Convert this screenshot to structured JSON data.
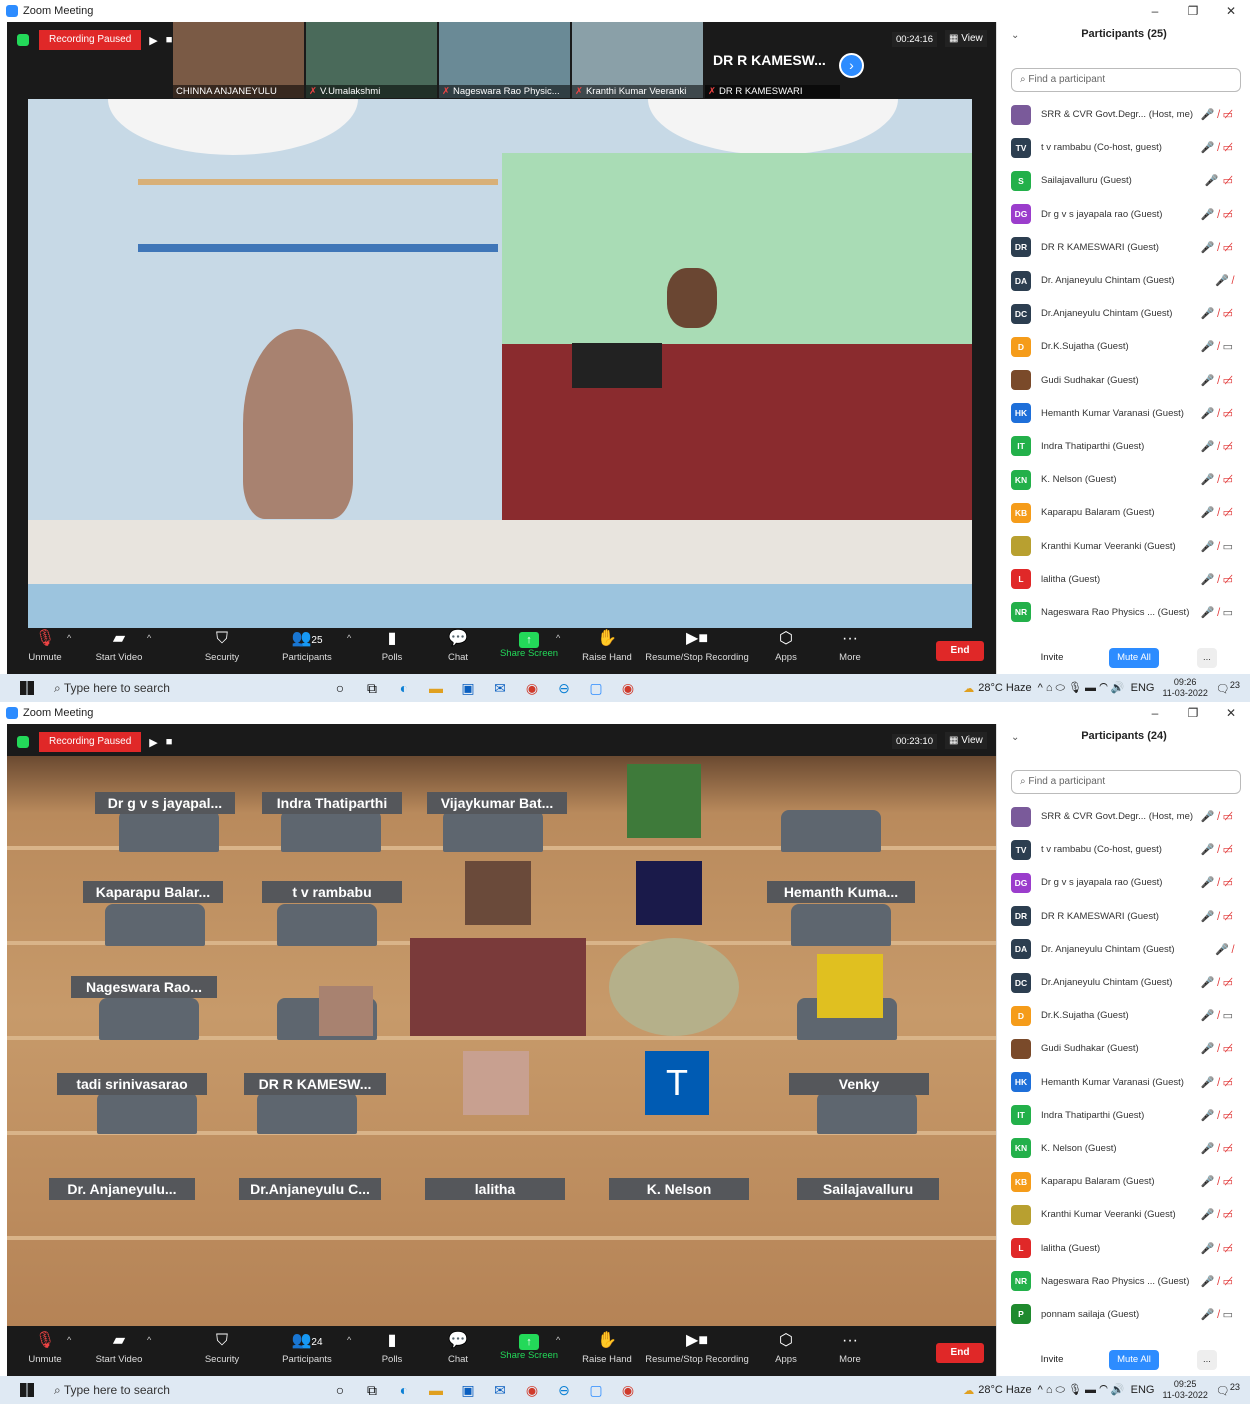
{
  "shot_a": {
    "window_title": "Zoom Meeting",
    "recording": "Recording Paused",
    "timer": "00:24:16",
    "view_label": "View",
    "thumbnails": [
      "CHINNA ANJANEYULU",
      "V.Umalakshmi",
      "Nageswara Rao Physic...",
      "Kranthi Kumar Veeranki"
    ],
    "name_tile_big": "DR R KAMESW...",
    "name_tile_small": "DR R KAMESWARI",
    "participants_title": "Participants (25)",
    "participants_count": "25",
    "participants": [
      {
        "initials": "",
        "name": "SRR & CVR Govt.Degr... (Host, me)",
        "color": "#7a5a9a",
        "icons": "mic-off cam-off"
      },
      {
        "initials": "TV",
        "name": "t v rambabu (Co-host, guest)",
        "color": "#2c3e50",
        "icons": "mic-off cam-off"
      },
      {
        "initials": "S",
        "name": "Sailajavalluru (Guest)",
        "color": "#23b04a",
        "icons": "mic-on cam-off"
      },
      {
        "initials": "DG",
        "name": "Dr g v s jayapala rao (Guest)",
        "color": "#9b3dcc",
        "icons": "mic-off cam-off"
      },
      {
        "initials": "DR",
        "name": "DR R KAMESWARI (Guest)",
        "color": "#2c3e50",
        "icons": "mic-off cam-off"
      },
      {
        "initials": "DA",
        "name": "Dr. Anjaneyulu Chintam (Guest)",
        "color": "#2c3e50",
        "icons": "mic-off"
      },
      {
        "initials": "DC",
        "name": "Dr.Anjaneyulu Chintam (Guest)",
        "color": "#2c3e50",
        "icons": "mic-off cam-off"
      },
      {
        "initials": "D",
        "name": "Dr.K.Sujatha (Guest)",
        "color": "#f59c1a",
        "icons": "mic-off cam-on"
      },
      {
        "initials": "",
        "name": "Gudi Sudhakar (Guest)",
        "color": "#7a4a2a",
        "icons": "mic-off cam-off"
      },
      {
        "initials": "HK",
        "name": "Hemanth Kumar Varanasi (Guest)",
        "color": "#1e6fd9",
        "icons": "mic-off cam-off"
      },
      {
        "initials": "IT",
        "name": "Indra Thatiparthi (Guest)",
        "color": "#23b04a",
        "icons": "mic-off cam-off"
      },
      {
        "initials": "KN",
        "name": "K. Nelson (Guest)",
        "color": "#23b04a",
        "icons": "mic-off cam-off"
      },
      {
        "initials": "KB",
        "name": "Kaparapu Balaram (Guest)",
        "color": "#f59c1a",
        "icons": "mic-off cam-off"
      },
      {
        "initials": "",
        "name": "Kranthi Kumar Veeranki (Guest)",
        "color": "#b8a030",
        "icons": "mic-off cam-on"
      },
      {
        "initials": "L",
        "name": "lalitha (Guest)",
        "color": "#e02828",
        "icons": "mic-off cam-off"
      },
      {
        "initials": "NR",
        "name": "Nageswara Rao Physics ... (Guest)",
        "color": "#23b04a",
        "icons": "mic-off cam-on"
      }
    ],
    "clock_time": "09:26",
    "clock_date": "11-03-2022"
  },
  "shot_b": {
    "window_title": "Zoom Meeting",
    "recording": "Recording Paused",
    "timer": "00:23:10",
    "view_label": "View",
    "participants_title": "Participants (24)",
    "participants_count": "24",
    "seat_tags": [
      "Dr g v s jayapal...",
      "Indra Thatiparthi",
      "Vijaykumar Bat...",
      "Kaparapu Balar...",
      "t v rambabu",
      "Hemanth Kuma...",
      "Nageswara Rao...",
      "tadi srinivasarao",
      "DR R KAMESW...",
      "Venky",
      "Dr. Anjaneyulu...",
      "Dr.Anjaneyulu C...",
      "lalitha",
      "K. Nelson",
      "Sailajavalluru"
    ],
    "t_avatar": "T",
    "participants": [
      {
        "initials": "",
        "name": "SRR & CVR Govt.Degr... (Host, me)",
        "color": "#7a5a9a",
        "icons": "mic-off cam-off"
      },
      {
        "initials": "TV",
        "name": "t v rambabu (Co-host, guest)",
        "color": "#2c3e50",
        "icons": "mic-off cam-off"
      },
      {
        "initials": "DG",
        "name": "Dr g v s jayapala rao (Guest)",
        "color": "#9b3dcc",
        "icons": "mic-off cam-off"
      },
      {
        "initials": "DR",
        "name": "DR R KAMESWARI (Guest)",
        "color": "#2c3e50",
        "icons": "mic-off cam-off"
      },
      {
        "initials": "DA",
        "name": "Dr. Anjaneyulu Chintam (Guest)",
        "color": "#2c3e50",
        "icons": "mic-off"
      },
      {
        "initials": "DC",
        "name": "Dr.Anjaneyulu Chintam (Guest)",
        "color": "#2c3e50",
        "icons": "mic-off cam-off"
      },
      {
        "initials": "D",
        "name": "Dr.K.Sujatha (Guest)",
        "color": "#f59c1a",
        "icons": "mic-off cam-on"
      },
      {
        "initials": "",
        "name": "Gudi Sudhakar (Guest)",
        "color": "#7a4a2a",
        "icons": "mic-off cam-off"
      },
      {
        "initials": "HK",
        "name": "Hemanth Kumar Varanasi (Guest)",
        "color": "#1e6fd9",
        "icons": "mic-off cam-off"
      },
      {
        "initials": "IT",
        "name": "Indra Thatiparthi (Guest)",
        "color": "#23b04a",
        "icons": "mic-off cam-off"
      },
      {
        "initials": "KN",
        "name": "K. Nelson (Guest)",
        "color": "#23b04a",
        "icons": "mic-off cam-off"
      },
      {
        "initials": "KB",
        "name": "Kaparapu Balaram (Guest)",
        "color": "#f59c1a",
        "icons": "mic-off cam-off"
      },
      {
        "initials": "",
        "name": "Kranthi Kumar Veeranki (Guest)",
        "color": "#b8a030",
        "icons": "mic-off cam-off"
      },
      {
        "initials": "L",
        "name": "lalitha (Guest)",
        "color": "#e02828",
        "icons": "mic-off cam-off"
      },
      {
        "initials": "NR",
        "name": "Nageswara Rao Physics ... (Guest)",
        "color": "#23b04a",
        "icons": "mic-off cam-off"
      },
      {
        "initials": "P",
        "name": "ponnam sailaja (Guest)",
        "color": "#1f8a2e",
        "icons": "mic-off cam-on"
      }
    ],
    "clock_time": "09:25",
    "clock_date": "11-03-2022"
  },
  "toolbar": {
    "unmute": "Unmute",
    "start_video": "Start Video",
    "security": "Security",
    "participants": "Participants",
    "polls": "Polls",
    "chat": "Chat",
    "share_screen": "Share Screen",
    "raise_hand": "Raise Hand",
    "resume_stop": "Resume/Stop Recording",
    "apps": "Apps",
    "more": "More",
    "end": "End"
  },
  "panel": {
    "search_placeholder": "Find a participant",
    "invite": "Invite",
    "mute_all": "Mute All",
    "more": "..."
  },
  "taskbar": {
    "search": "Type here to search",
    "weather": "28°C  Haze",
    "lang": "ENG",
    "notif": "23"
  },
  "colors": {
    "accent": "#2d8cff",
    "record_red": "#e02828",
    "share_green": "#23d959"
  }
}
